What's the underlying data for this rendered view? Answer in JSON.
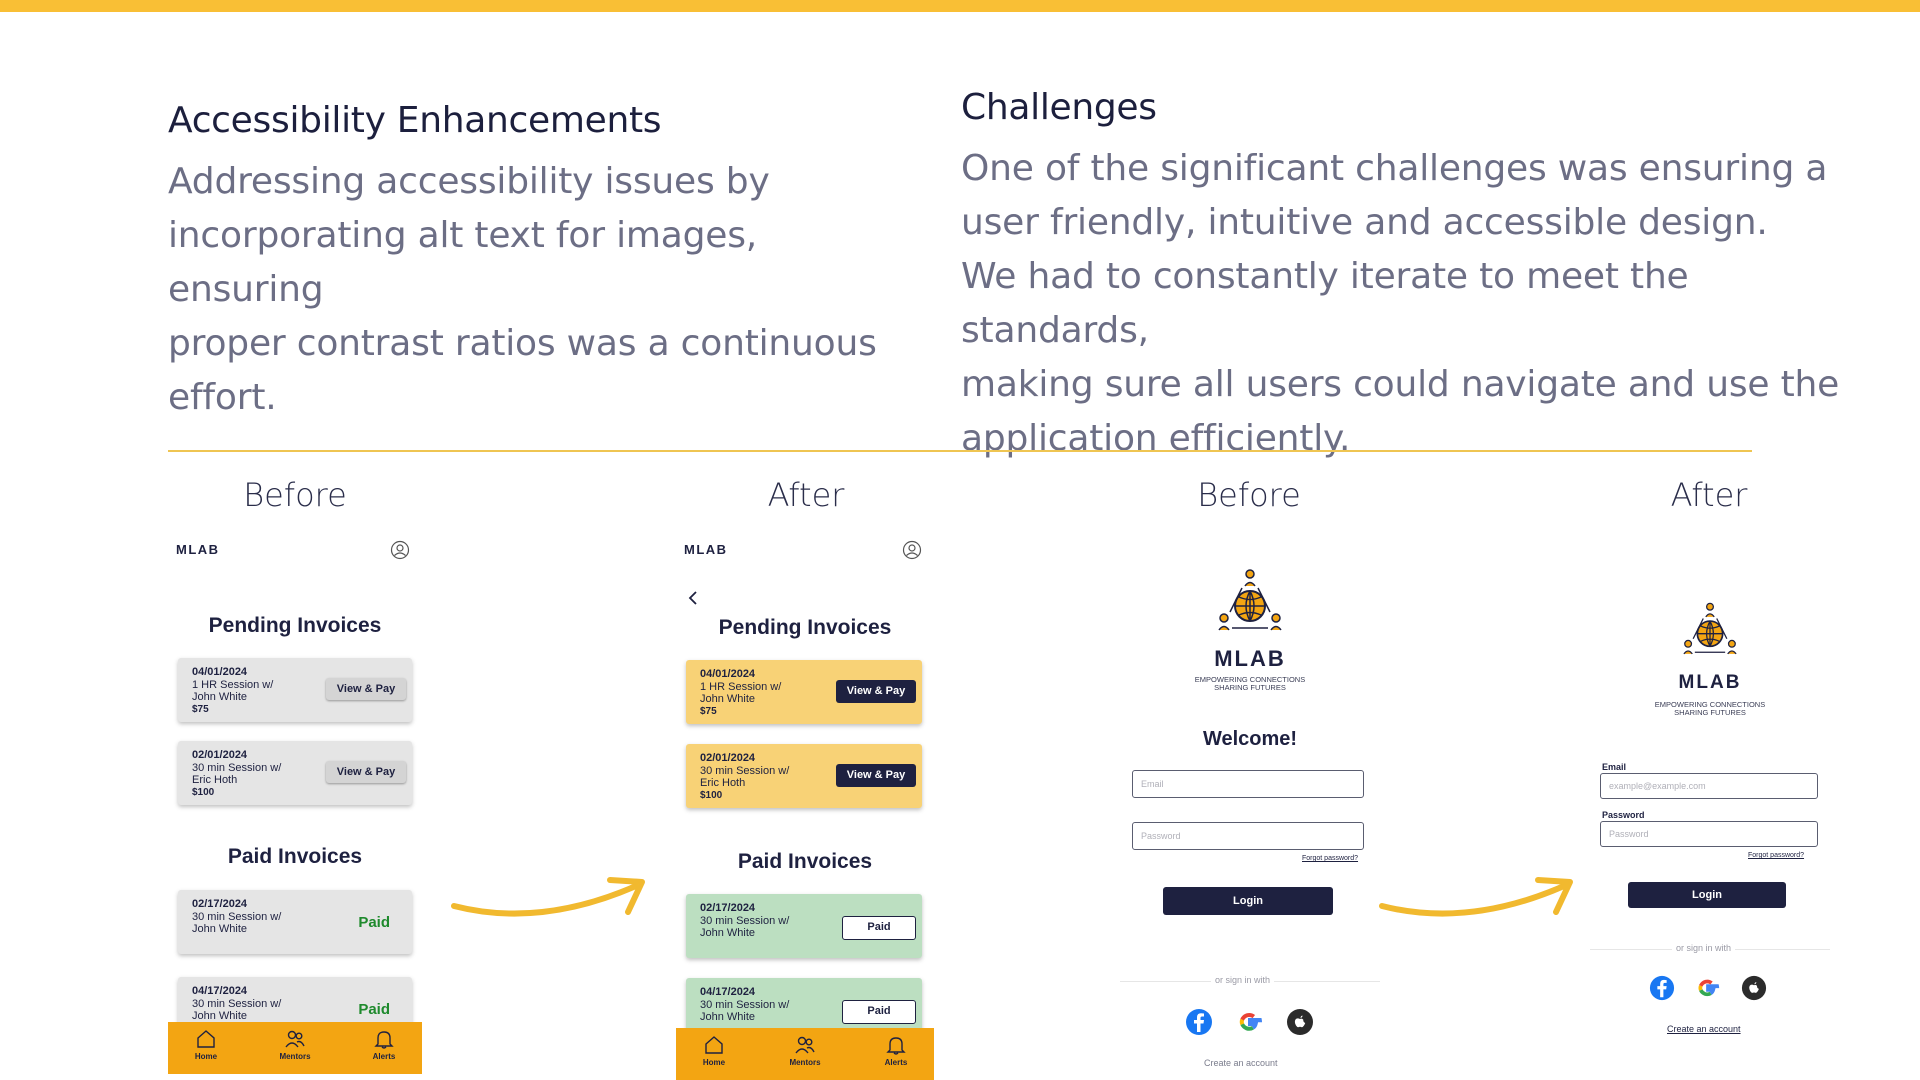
{
  "accessibility": {
    "heading": "Accessibility Enhancements",
    "lines": [
      "Addressing accessibility issues by",
      "incorporating alt text for images, ensuring",
      "proper contrast ratios was a continuous",
      "effort."
    ]
  },
  "challenges": {
    "heading": "Challenges",
    "lines": [
      "One of the significant challenges was ensuring a",
      "user friendly, intuitive and accessible design.",
      "We had to constantly iterate to meet the standards,",
      "making sure all users could navigate and use the",
      "application efficiently."
    ]
  },
  "labels": {
    "before": "Before",
    "after": "After"
  },
  "invoice_screen": {
    "brand": "MLAB",
    "pending_title": "Pending Invoices",
    "paid_title": "Paid Invoices",
    "pending": [
      {
        "date": "04/01/2024",
        "line1": "1 HR Session w/",
        "line2": "John White",
        "price": "$75",
        "action": "View & Pay"
      },
      {
        "date": "02/01/2024",
        "line1": "30 min Session w/",
        "line2": "Eric Hoth",
        "price": "$100",
        "action": "View & Pay"
      }
    ],
    "paid": [
      {
        "date": "02/17/2024",
        "line1": "30 min Session w/",
        "line2": "John White",
        "status": "Paid"
      },
      {
        "date": "04/17/2024",
        "line1": "30 min Session w/",
        "line2": "John White",
        "status": "Paid"
      }
    ],
    "nav": {
      "home": "Home",
      "mentors": "Mentors",
      "alerts": "Alerts"
    }
  },
  "login_screen": {
    "brand": "MLAB",
    "tagline_1": "EMPOWERING CONNECTIONS",
    "tagline_2": "SHARING FUTURES",
    "welcome": "Welcome!",
    "email_placeholder_old": "Email",
    "password_placeholder": "Password",
    "email_label": "Email",
    "password_label": "Password",
    "email_placeholder_new": "example@example.com",
    "forgot": "Forgot password?",
    "login": "Login",
    "or_sign_in": "or sign in with",
    "create_account": "Create an account"
  },
  "colors": {
    "accent_yellow": "#f9bf35",
    "nav_orange": "#f3a512",
    "navy": "#1e2140",
    "pending_yellow": "#f8d276",
    "paid_green": "#bcdfc1",
    "paid_text_green": "#1f8a2d"
  }
}
